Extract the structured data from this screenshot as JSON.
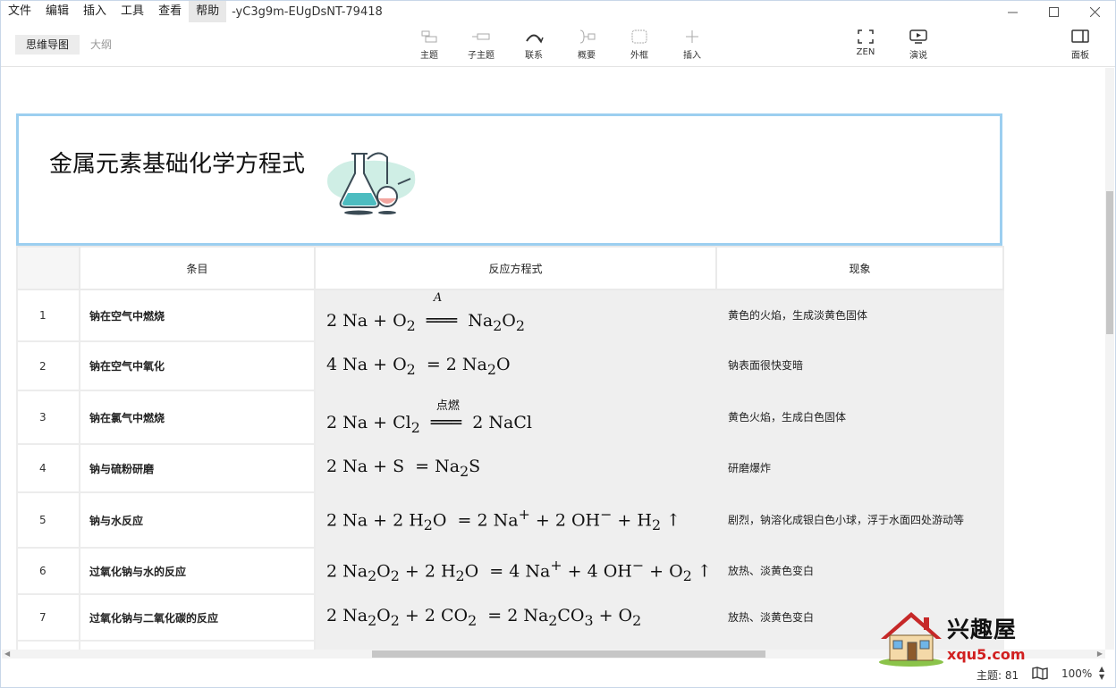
{
  "menu": {
    "items": [
      "文件",
      "编辑",
      "插入",
      "工具",
      "查看",
      "帮助"
    ],
    "active_index": 5,
    "doc_title": "-yC3g9m-EUgDsNT-79418"
  },
  "view_tabs": [
    "思维导图",
    "大纲"
  ],
  "toolbar": {
    "topic": "主题",
    "subtopic": "子主题",
    "relation": "联系",
    "summary": "概要",
    "boundary": "外框",
    "insert": "插入",
    "zen": "ZEN",
    "present": "演说",
    "panel": "面板"
  },
  "title": "金属元素基础化学方程式",
  "table": {
    "headers": [
      "",
      "条目",
      "反应方程式",
      "现象"
    ],
    "rows": [
      {
        "n": "1",
        "item": "钠在空气中燃烧",
        "obs": "黄色的火焰，生成淡黄色固体"
      },
      {
        "n": "2",
        "item": "钠在空气中氧化",
        "obs": "钠表面很快变暗"
      },
      {
        "n": "3",
        "item": "钠在氯气中燃烧",
        "obs": "黄色火焰，生成白色固体"
      },
      {
        "n": "4",
        "item": "钠与硫粉研磨",
        "obs": "研磨爆炸"
      },
      {
        "n": "5",
        "item": "钠与水反应",
        "obs": "剧烈，钠溶化成银白色小球，浮于水面四处游动等"
      },
      {
        "n": "6",
        "item": "过氧化钠与水的反应",
        "obs": "放热、淡黄色变白"
      },
      {
        "n": "7",
        "item": "过氧化钠与二氧化碳的反应",
        "obs": "放热、淡黄色变白"
      }
    ],
    "conditions": {
      "heat": "A",
      "ignite": "点燃"
    }
  },
  "status": {
    "topics": "主题: 81",
    "zoom": "100%"
  },
  "watermark": {
    "name": "兴趣屋",
    "url": "xqu5.com"
  }
}
